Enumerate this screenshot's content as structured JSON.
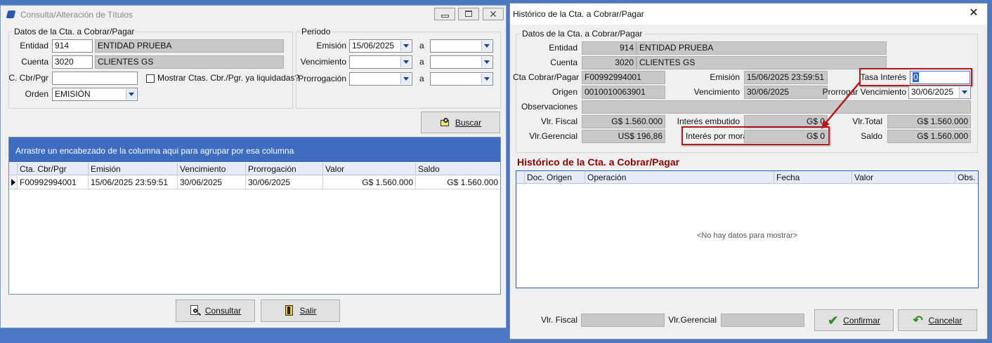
{
  "left_window": {
    "title": "Consulta/Alteración de Títulos",
    "datos_group": "Datos de la Cta. a Cobrar/Pagar",
    "entidad_label": "Entidad",
    "entidad_code": "914",
    "entidad_name": "ENTIDAD PRUEBA",
    "cuenta_label": "Cuenta",
    "cuenta_code": "3020",
    "cuenta_name": "CLIENTES GS",
    "ccbr_label": "C. Cbr/Pgr",
    "ccbr_value": "",
    "mostrar_label": "Mostrar Ctas. Cbr./Pgr. ya liquidadas?",
    "mostrar_checked": false,
    "orden_label": "Orden",
    "orden_value": "EMISIÓN",
    "periodo_group": "Periodo",
    "emision_label": "Emisión",
    "emision_from": "15/06/2025",
    "emision_to": "",
    "vencimiento_label": "Vencimiento",
    "prorrogacion_label": "Prorrogación",
    "a_label": "a",
    "buscar_label": "Buscar",
    "group_hint": "Arrastre un encabezado de la columna aqui para agrupar por esa columna",
    "columns": [
      "Cta. Cbr/Pgr",
      "Emisión",
      "Vencimiento",
      "Prorrogación",
      "Valor",
      "Saldo"
    ],
    "rows": [
      {
        "cta": "F00992994001",
        "emision": "15/06/2025 23:59:51",
        "vencimiento": "30/06/2025",
        "prorrogacion": "30/06/2025",
        "valor": "G$ 1.560.000",
        "saldo": "G$ 1.560.000"
      }
    ],
    "consultar_label": "Consultar",
    "salir_label": "Salir"
  },
  "right_window": {
    "title": "Histórico de la Cta. a Cobrar/Pagar",
    "datos_group": "Datos de la Cta. a Cobrar/Pagar",
    "entidad_label": "Entidad",
    "entidad_code": "914",
    "entidad_name": "ENTIDAD PRUEBA",
    "cuenta_label": "Cuenta",
    "cuenta_code": "3020",
    "cuenta_name": "CLIENTES GS",
    "cta_label": "Cta Cobrar/Pagar",
    "cta_value": "F00992994001",
    "emision_label": "Emisión",
    "emision_value": "15/06/2025 23:59:51",
    "tasa_label": "Tasa Interés",
    "tasa_value": "0",
    "origen_label": "Origen",
    "origen_value": "0010010063901",
    "venc_label": "Vencimiento",
    "venc_value": "30/06/2025",
    "prorrogar_label": "Prorrogar Vencimiento",
    "prorrogar_value": "30/06/2025",
    "obs_label": "Observaciones",
    "obs_value": "",
    "vlr_fiscal_label": "Vlr. Fiscal",
    "vlr_fiscal_value": "G$ 1.560.000",
    "int_emb_label": "Interés embutido",
    "int_emb_value": "G$ 0",
    "vlr_total_label": "Vlr.Total",
    "vlr_total_value": "G$ 1.560.000",
    "vlr_ger_label": "Vlr.Gerencial",
    "vlr_ger_value": "US$ 196,86",
    "int_mora_label": "Interés por mora",
    "int_mora_value": "G$ 0",
    "saldo_label": "Saldo",
    "saldo_value": "G$ 1.560.000",
    "historico_title": "Histórico de la Cta. a Cobrar/Pagar",
    "columns": [
      "Doc. Origen",
      "Operación",
      "Fecha",
      "Valor",
      "Obs."
    ],
    "empty_text": "<No hay datos para mostrar>",
    "footer_fiscal_label": "Vlr. Fiscal",
    "footer_ger_label": "Vlr.Gerencial",
    "confirmar_label": "Confirmar",
    "cancelar_label": "Cancelar"
  },
  "colors": {
    "accent": "#2f5fa8",
    "highlight_red": "#b01a1a",
    "title_red": "#8b0000",
    "confirm_green": "#2e8b2e"
  }
}
